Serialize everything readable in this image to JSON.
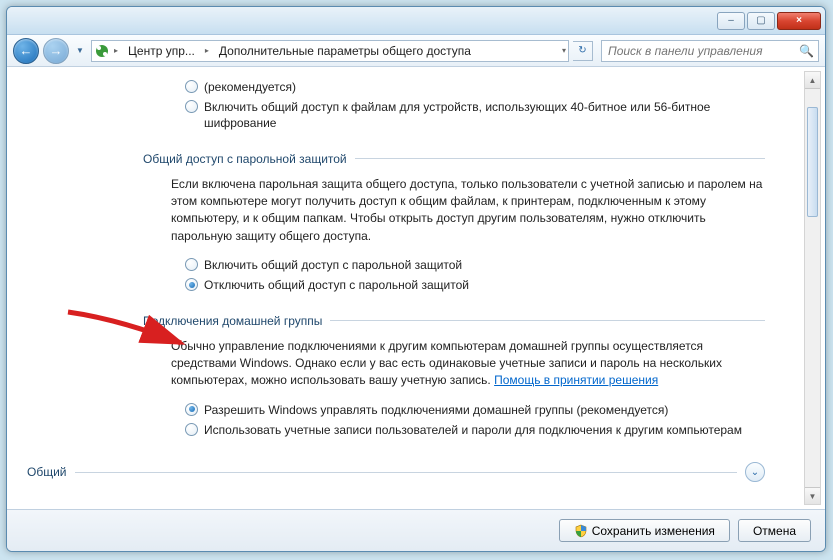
{
  "titlebar": {
    "minimize": "–",
    "maximize": "▢",
    "close": "×"
  },
  "nav": {
    "crumb1": "Центр упр...",
    "crumb2": "Дополнительные параметры общего доступа",
    "search_placeholder": "Поиск в панели управления"
  },
  "encryption": {
    "opt_recommended_suffix": "(рекомендуется)",
    "opt_legacy": "Включить общий доступ к файлам для устройств, использующих 40-битное или 56-битное шифрование"
  },
  "password_section": {
    "title": "Общий доступ с парольной защитой",
    "desc": "Если включена парольная защита общего доступа, только пользователи с учетной записью и паролем на этом компьютере могут получить доступ к общим файлам, к принтерам, подключенным к этому компьютеру, и к общим папкам. Чтобы открыть доступ другим пользователям, нужно отключить парольную защиту общего доступа.",
    "opt_on": "Включить общий доступ с парольной защитой",
    "opt_off": "Отключить общий доступ с парольной защитой"
  },
  "homegroup_section": {
    "title": "Подключения домашней группы",
    "desc_pre": "Обычно управление подключениями к другим компьютерам домашней группы осуществляется средствами Windows. Однако если у вас есть одинаковые учетные записи и пароль на нескольких компьютерах, можно использовать вашу учетную запись. ",
    "help_link": "Помощь в принятии решения",
    "opt_windows": "Разрешить Windows управлять подключениями домашней группы (рекомендуется)",
    "opt_user": "Использовать учетные записи пользователей и пароли для подключения к другим компьютерам"
  },
  "expand": {
    "label": "Общий"
  },
  "footer": {
    "save": "Сохранить изменения",
    "cancel": "Отмена"
  }
}
